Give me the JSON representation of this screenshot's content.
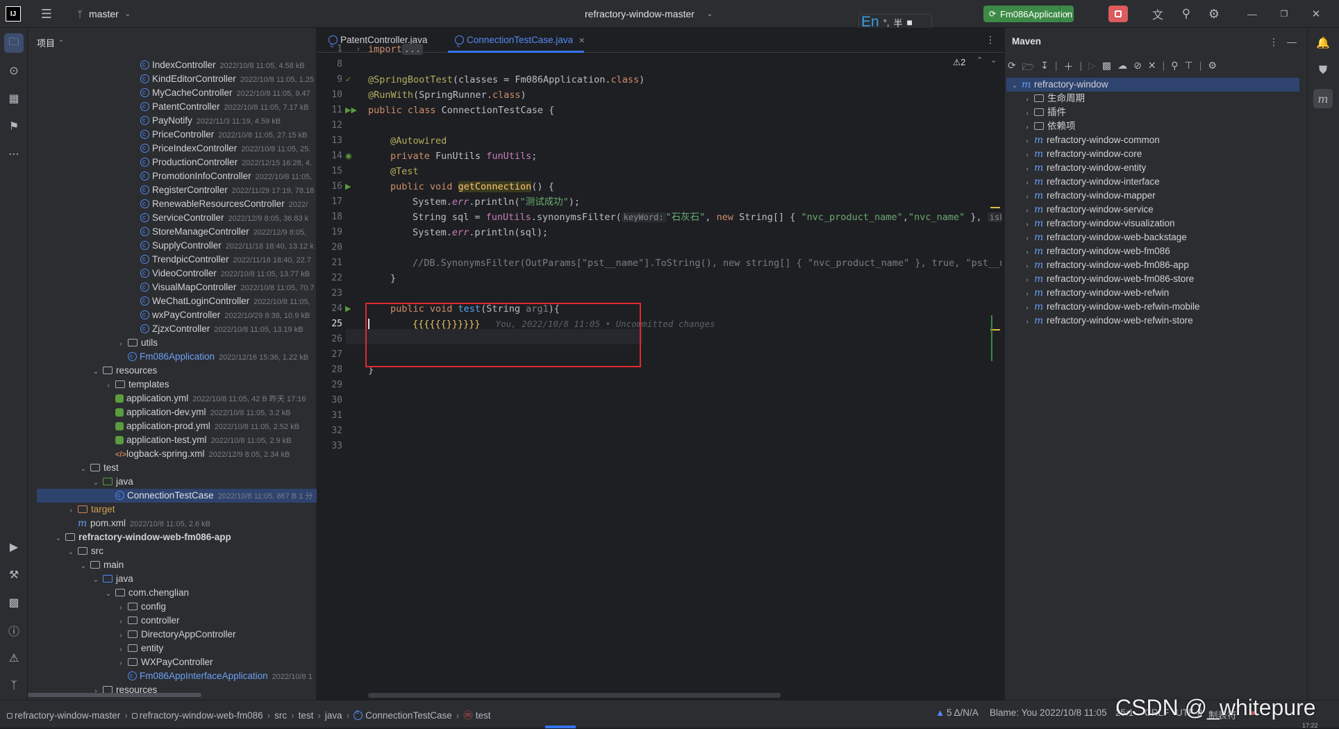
{
  "titlebar": {
    "branch": "master",
    "project_name": "refractory-window-master",
    "run_config": "Fm086Application",
    "ime": {
      "lang": "En",
      "punct": "°,",
      "width": "半"
    }
  },
  "project_panel": {
    "title": "项目",
    "rows": [
      {
        "indent": 7,
        "type": "class",
        "name": "IndexController",
        "meta": "2022/10/8 11:05, 4.58 kB"
      },
      {
        "indent": 7,
        "type": "class",
        "name": "KindEditorController",
        "meta": "2022/10/8 11:05, 1.25"
      },
      {
        "indent": 7,
        "type": "class",
        "name": "MyCacheController",
        "meta": "2022/10/8 11:05, 9.47"
      },
      {
        "indent": 7,
        "type": "class",
        "name": "PatentController",
        "meta": "2022/10/8 11:05, 7.17 kB"
      },
      {
        "indent": 7,
        "type": "class",
        "name": "PayNotify",
        "meta": "2022/11/3 11:19, 4.59 kB"
      },
      {
        "indent": 7,
        "type": "class",
        "name": "PriceController",
        "meta": "2022/10/8 11:05, 27.15 kB"
      },
      {
        "indent": 7,
        "type": "class",
        "name": "PriceIndexController",
        "meta": "2022/10/8 11:05, 25."
      },
      {
        "indent": 7,
        "type": "class",
        "name": "ProductionController",
        "meta": "2022/12/15 16:28, 4."
      },
      {
        "indent": 7,
        "type": "class",
        "name": "PromotionInfoController",
        "meta": "2022/10/8 11:05,"
      },
      {
        "indent": 7,
        "type": "class",
        "name": "RegisterController",
        "meta": "2022/11/29 17:19, 78.18"
      },
      {
        "indent": 7,
        "type": "class",
        "name": "RenewableResourcesController",
        "meta": "2022/"
      },
      {
        "indent": 7,
        "type": "class",
        "name": "ServiceController",
        "meta": "2022/12/9 8:05, 36.83 k"
      },
      {
        "indent": 7,
        "type": "class",
        "name": "StoreManageController",
        "meta": "2022/12/9 8:05,"
      },
      {
        "indent": 7,
        "type": "class",
        "name": "SupplyController",
        "meta": "2022/11/18 18:40, 13.12 k"
      },
      {
        "indent": 7,
        "type": "class",
        "name": "TrendpicController",
        "meta": "2022/11/18 18:40, 22.7"
      },
      {
        "indent": 7,
        "type": "class",
        "name": "VideoController",
        "meta": "2022/10/8 11:05, 13.77 kB"
      },
      {
        "indent": 7,
        "type": "class",
        "name": "VisualMapController",
        "meta": "2022/10/8 11:05, 70.7"
      },
      {
        "indent": 7,
        "type": "class",
        "name": "WeChatLoginController",
        "meta": "2022/10/8 11:05,"
      },
      {
        "indent": 7,
        "type": "class",
        "name": "wxPayController",
        "meta": "2022/10/29 8:38, 10.9 kB"
      },
      {
        "indent": 7,
        "type": "class",
        "name": "ZjzxController",
        "meta": "2022/10/8 11:05, 13.19 kB"
      },
      {
        "indent": 6,
        "type": "folder",
        "chev": ">",
        "name": "utils",
        "meta": ""
      },
      {
        "indent": 6,
        "type": "app",
        "name": "Fm086Application",
        "meta": "2022/12/16 15:36, 1.22 kB"
      },
      {
        "indent": 4,
        "type": "folder",
        "chev": "v",
        "name": "resources",
        "meta": ""
      },
      {
        "indent": 5,
        "type": "folder",
        "chev": ">",
        "name": "templates",
        "meta": ""
      },
      {
        "indent": 5,
        "type": "yml",
        "name": "application.yml",
        "meta": "2022/10/8 11:05, 42 B 昨天 17:16"
      },
      {
        "indent": 5,
        "type": "yml",
        "name": "application-dev.yml",
        "meta": "2022/10/8 11:05, 3.2 kB"
      },
      {
        "indent": 5,
        "type": "yml",
        "name": "application-prod.yml",
        "meta": "2022/10/8 11:05, 2.52 kB"
      },
      {
        "indent": 5,
        "type": "yml",
        "name": "application-test.yml",
        "meta": "2022/10/8 11:05, 2.9 kB"
      },
      {
        "indent": 5,
        "type": "xml",
        "name": "logback-spring.xml",
        "meta": "2022/12/9 8:05, 2.34 kB"
      },
      {
        "indent": 3,
        "type": "folder",
        "chev": "v",
        "name": "test",
        "meta": ""
      },
      {
        "indent": 4,
        "type": "folder-green",
        "chev": "v",
        "name": "java",
        "meta": ""
      },
      {
        "indent": 5,
        "type": "class",
        "name": "ConnectionTestCase",
        "meta": "2022/10/8 11:05, 867 B 1 分",
        "selected": true
      },
      {
        "indent": 2,
        "type": "folder-orange",
        "chev": ">",
        "name": "target",
        "meta": ""
      },
      {
        "indent": 2,
        "type": "maven",
        "name": "pom.xml",
        "meta": "2022/10/8 11:05, 2.6 kB"
      },
      {
        "indent": 1,
        "type": "module",
        "chev": "v",
        "name": "refractory-window-web-fm086-app",
        "meta": "",
        "bold": true
      },
      {
        "indent": 2,
        "type": "folder",
        "chev": "v",
        "name": "src",
        "meta": ""
      },
      {
        "indent": 3,
        "type": "folder",
        "chev": "v",
        "name": "main",
        "meta": ""
      },
      {
        "indent": 4,
        "type": "folder-blue",
        "chev": "v",
        "name": "java",
        "meta": ""
      },
      {
        "indent": 5,
        "type": "folder",
        "chev": "v",
        "name": "com.chenglian",
        "meta": ""
      },
      {
        "indent": 6,
        "type": "folder",
        "chev": ">",
        "name": "config",
        "meta": ""
      },
      {
        "indent": 6,
        "type": "folder",
        "chev": ">",
        "name": "controller",
        "meta": ""
      },
      {
        "indent": 6,
        "type": "folder",
        "chev": ">",
        "name": "DirectoryAppController",
        "meta": ""
      },
      {
        "indent": 6,
        "type": "folder",
        "chev": ">",
        "name": "entity",
        "meta": ""
      },
      {
        "indent": 6,
        "type": "folder",
        "chev": ">",
        "name": "WXPayController",
        "meta": ""
      },
      {
        "indent": 6,
        "type": "app",
        "name": "Fm086AppInterfaceApplication",
        "meta": "2022/10/8 1"
      },
      {
        "indent": 4,
        "type": "folder",
        "chev": ">",
        "name": "resources",
        "meta": ""
      }
    ]
  },
  "editor": {
    "tabs": [
      {
        "label": "PatentController.java",
        "active": false
      },
      {
        "label": "ConnectionTestCase.java",
        "active": true
      }
    ],
    "warnings": "⚠2",
    "line_numbers": [
      "1",
      "8",
      "9",
      "10",
      "11",
      "12",
      "13",
      "14",
      "15",
      "16",
      "17",
      "18",
      "19",
      "20",
      "21",
      "22",
      "23",
      "24",
      "25",
      "26",
      "27",
      "28",
      "29",
      "30",
      "31",
      "32",
      "33"
    ],
    "current_line": "25",
    "blame_inline": "You, 2022/10/8 11:05 • Uncommitted changes",
    "code_text": {
      "import": "import",
      "import_fold": "...",
      "anno_boot": "@SpringBootTest",
      "boot_args_a": "(classes = Fm086Application.",
      "boot_args_kw": "class",
      "boot_args_b": ")",
      "anno_runwith": "@RunWith",
      "runwith_a": "(SpringRunner.",
      "runwith_kw": "class",
      "runwith_b": ")",
      "public_class": "public class ",
      "class_name": "ConnectionTestCase {",
      "anno_autowired": "@Autowired",
      "private_kw": "private ",
      "field_type": "FunUtils ",
      "field_name": "funUtils",
      "semi": ";",
      "anno_test": "@Test",
      "public_void": "public void ",
      "method_get": "getConnection",
      "method_get_rest": "() {",
      "sys": "System.",
      "err": "err",
      "println_open": ".println(",
      "str_success": "\"测试成功\"",
      "close_semi": ");",
      "string_sql": "String sql = ",
      "funutils_call": "funUtils",
      "syn_filter": ".synonymsFilter(",
      "hint_keyword": "keyWord:",
      "str_stone": "\"石灰石\"",
      "comma_new": ", ",
      "new_kw": "new ",
      "string_arr": "String[] { ",
      "str_prod": "\"nvc_product_name\"",
      "comma": ",",
      "str_name": "\"nvc_name\"",
      "close_arr": " }, ",
      "hint_isfu": "isFu",
      "println_sql": ".println(sql);",
      "comment_line": "//DB.SynonymsFilter(OutParams[\"pst__name\"].ToString(), new string[] { \"nvc_product_name\" }, true, \"pst__na",
      "close_brace": "}",
      "method_test": "test",
      "test_params_a": "(String ",
      "test_param": "arg1",
      "test_params_b": "){",
      "braces_line": "{{{{{{}}}}}}",
      "close_brace_2": "}",
      "close_class": "}"
    }
  },
  "maven": {
    "title": "Maven",
    "root": "refractory-window",
    "items": [
      {
        "type": "folder",
        "label": "生命周期"
      },
      {
        "type": "folder",
        "label": "插件"
      },
      {
        "type": "folder",
        "label": "依赖项"
      },
      {
        "type": "module",
        "label": "refractory-window-common"
      },
      {
        "type": "module",
        "label": "refractory-window-core"
      },
      {
        "type": "module",
        "label": "refractory-window-entity"
      },
      {
        "type": "module",
        "label": "refractory-window-interface"
      },
      {
        "type": "module",
        "label": "refractory-window-mapper"
      },
      {
        "type": "module",
        "label": "refractory-window-service"
      },
      {
        "type": "module",
        "label": "refractory-window-visualization"
      },
      {
        "type": "module",
        "label": "refractory-window-web-backstage"
      },
      {
        "type": "module",
        "label": "refractory-window-web-fm086"
      },
      {
        "type": "module",
        "label": "refractory-window-web-fm086-app"
      },
      {
        "type": "module",
        "label": "refractory-window-web-fm086-store"
      },
      {
        "type": "module",
        "label": "refractory-window-web-refwin"
      },
      {
        "type": "module",
        "label": "refractory-window-web-refwin-mobile"
      },
      {
        "type": "module",
        "label": "refractory-window-web-refwin-store"
      }
    ]
  },
  "statusbar": {
    "breadcrumb": [
      "refractory-window-master",
      "refractory-window-web-fm086",
      "src",
      "test",
      "java",
      "ConnectionTestCase",
      "test"
    ],
    "warnings": "5 Δ/N/A",
    "blame": "Blame: You 2022/10/8 11:05",
    "pos": "25:1",
    "crlf": "CRLF",
    "encoding": "UTF-8",
    "indent": "制表符",
    "watermark": "CSDN @_whitepure",
    "time": "17:22"
  },
  "colors": {
    "accent": "#3574f0",
    "run_button": "#3d8a47",
    "stop_button": "#db5c5c",
    "highlight_box": "#e0292f"
  }
}
